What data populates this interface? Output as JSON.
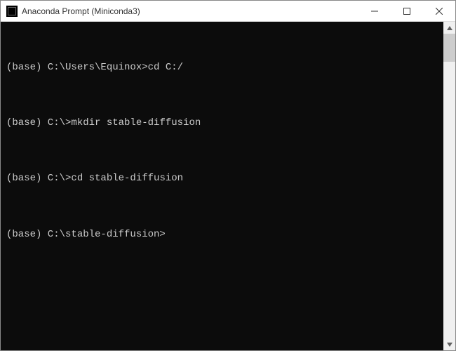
{
  "window": {
    "title": "Anaconda Prompt (Miniconda3)"
  },
  "terminal": {
    "lines": [
      {
        "prompt": "(base) C:\\Users\\Equinox>",
        "command": "cd C:/"
      },
      {
        "prompt": "(base) C:\\>",
        "command": "mkdir stable-diffusion"
      },
      {
        "prompt": "(base) C:\\>",
        "command": "cd stable-diffusion"
      },
      {
        "prompt": "(base) C:\\stable-diffusion>",
        "command": ""
      }
    ]
  }
}
